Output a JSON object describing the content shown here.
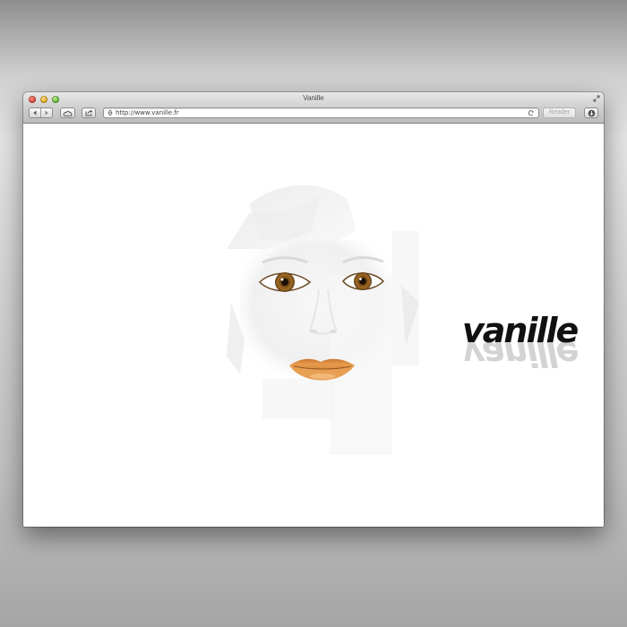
{
  "window": {
    "title": "Vanille"
  },
  "toolbar": {
    "back_icon": "back-arrow-icon",
    "forward_icon": "forward-arrow-icon",
    "cloud_icon": "icloud-tabs-icon",
    "share_icon": "share-icon",
    "download_icon": "downloads-icon",
    "reader_label": "Reader"
  },
  "address_bar": {
    "url": "http://www.vanille.fr",
    "site_icon": "site-favicon-icon",
    "reload_icon": "reload-icon"
  },
  "page": {
    "logo_text": "vanille",
    "logo_color": "#111111",
    "accent_colors": {
      "eyes": "#8a5a1e",
      "lips": "#d2873c"
    },
    "background": "#ffffff"
  }
}
